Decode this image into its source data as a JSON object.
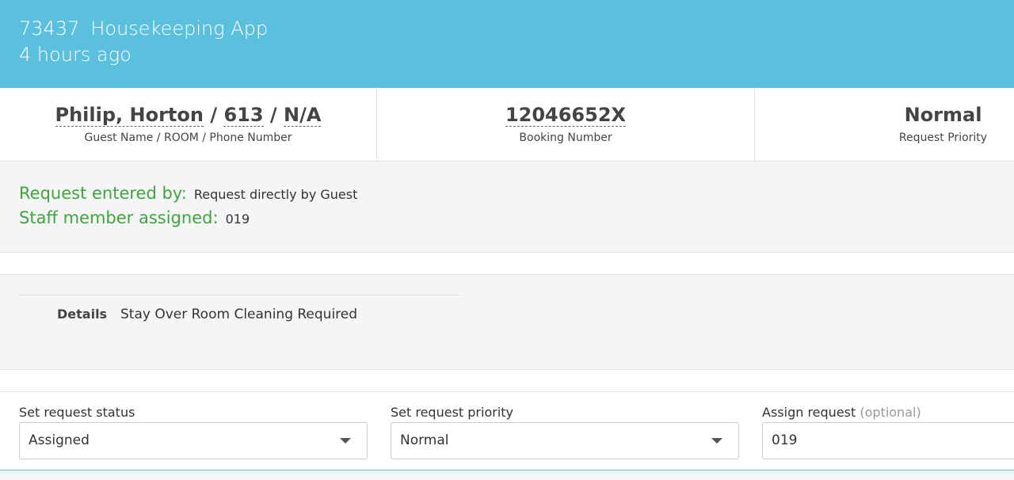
{
  "header": {
    "request_id": "73437",
    "app_name": "Housekeeping App",
    "time_ago": "4 hours ago",
    "color": "#5bc0de"
  },
  "summary": {
    "guest_name": "Philip, Horton",
    "room": "613",
    "phone": "N/A",
    "separator": " / ",
    "guest_label": "Guest Name / ROOM / Phone Number",
    "booking_number": "12046652X",
    "booking_label": "Booking Number",
    "priority": "Normal",
    "priority_label": "Request Priority"
  },
  "entered": {
    "entered_by_key": "Request entered by:",
    "entered_by_value": "Request directly by Guest",
    "staff_key": "Staff member assigned:",
    "staff_value": "019",
    "key_color": "#3ea63e"
  },
  "details": {
    "label": "Details",
    "value": "Stay Over Room Cleaning Required"
  },
  "form": {
    "status_label": "Set request status",
    "status_value": "Assigned",
    "priority_label": "Set request priority",
    "priority_value": "Normal",
    "assign_label": "Assign request",
    "assign_optional": "(optional)",
    "assign_value": "019"
  }
}
